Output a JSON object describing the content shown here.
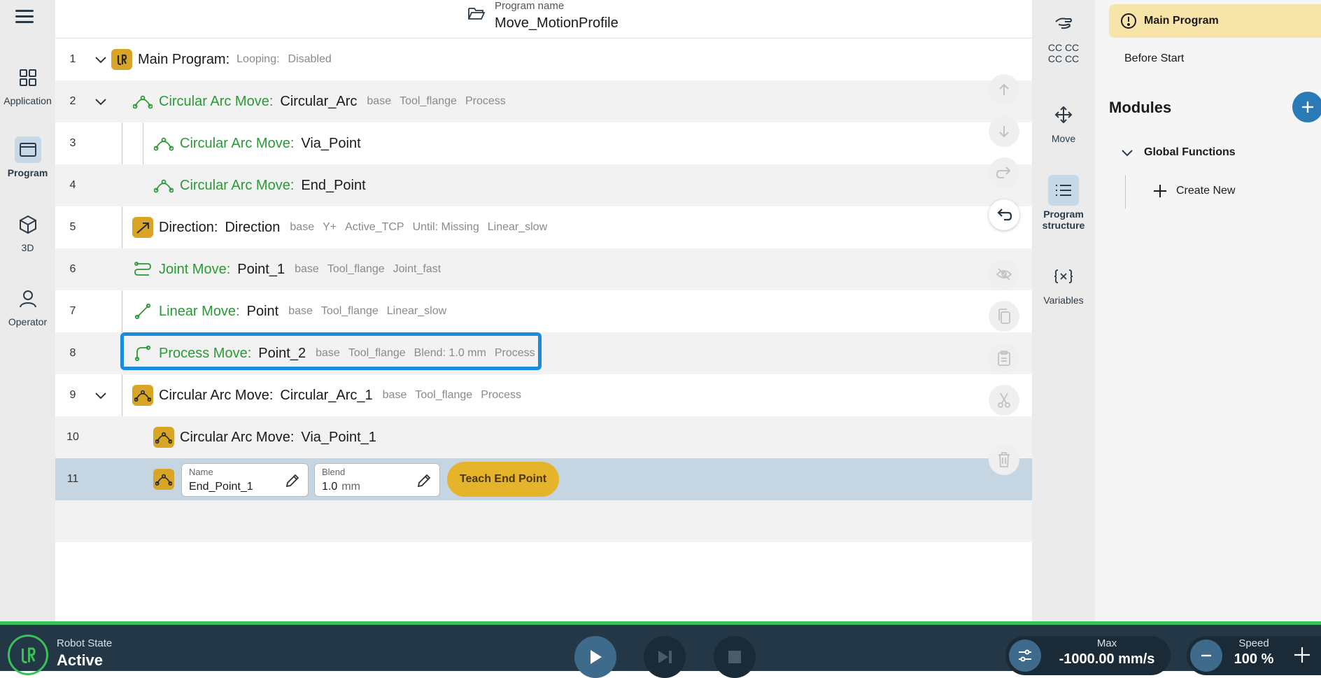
{
  "app": {
    "accent": "#1a8ce0",
    "gold": "#d9a526",
    "green": "#2a9a37"
  },
  "leftnav": {
    "items": [
      {
        "label": "Application",
        "icon": "grid-icon"
      },
      {
        "label": "Program",
        "icon": "program-window-icon"
      },
      {
        "label": "3D",
        "icon": "cube-icon"
      },
      {
        "label": "Operator",
        "icon": "person-icon"
      }
    ]
  },
  "header": {
    "program_name_label": "Program name",
    "program_name": "Move_MotionProfile"
  },
  "tree": {
    "rows": [
      {
        "num": "1",
        "type": "Main Program:",
        "name": "",
        "meta": [
          "Looping:",
          "Disabled"
        ]
      },
      {
        "num": "2",
        "type": "Circular Arc Move:",
        "name": "Circular_Arc",
        "meta": [
          "base",
          "Tool_flange",
          "Process"
        ]
      },
      {
        "num": "3",
        "type": "Circular Arc Move:",
        "name": "Via_Point",
        "meta": []
      },
      {
        "num": "4",
        "type": "Circular Arc Move:",
        "name": "End_Point",
        "meta": []
      },
      {
        "num": "5",
        "type": "Direction:",
        "name": "Direction",
        "meta": [
          "base",
          "Y+",
          "Active_TCP",
          "Until: Missing",
          "Linear_slow"
        ]
      },
      {
        "num": "6",
        "type": "Joint Move:",
        "name": "Point_1",
        "meta": [
          "base",
          "Tool_flange",
          "Joint_fast"
        ]
      },
      {
        "num": "7",
        "type": "Linear Move:",
        "name": "Point",
        "meta": [
          "base",
          "Tool_flange",
          "Linear_slow"
        ]
      },
      {
        "num": "8",
        "type": "Process Move:",
        "name": "Point_2",
        "meta": [
          "base",
          "Tool_flange",
          "Blend: 1.0 mm",
          "Process"
        ]
      },
      {
        "num": "9",
        "type": "Circular Arc Move:",
        "name": "Circular_Arc_1",
        "meta": [
          "base",
          "Tool_flange",
          "Process"
        ]
      },
      {
        "num": "10",
        "type": "Circular Arc Move:",
        "name": "Via_Point_1",
        "meta": []
      },
      {
        "num": "11"
      }
    ],
    "edit": {
      "name_label": "Name",
      "name_value": "End_Point_1",
      "blend_label": "Blend",
      "blend_value": "1.0",
      "blend_unit": "mm",
      "teach_button": "Teach End Point"
    }
  },
  "tools": {
    "items": [
      {
        "label": "CC CC\nCC CC",
        "line1": "CC CC",
        "line2": "CC CC",
        "icon": "freedrive-hand-icon"
      },
      {
        "label": "Move",
        "icon": "move-arrows-icon"
      },
      {
        "label": "Program structure",
        "line1": "Program",
        "line2": "structure",
        "icon": "list-icon"
      },
      {
        "label": "Variables",
        "icon": "variables-icon"
      }
    ]
  },
  "panel": {
    "main_program": "Main Program",
    "before_start": "Before Start",
    "modules_title": "Modules",
    "global_functions": "Global Functions",
    "create_new": "Create New"
  },
  "bottombar": {
    "robot_state_label": "Robot State",
    "robot_state": "Active",
    "max_label": "Max",
    "max_value": "-1000.00 mm/s",
    "speed_label": "Speed",
    "speed_value": "100 %"
  }
}
